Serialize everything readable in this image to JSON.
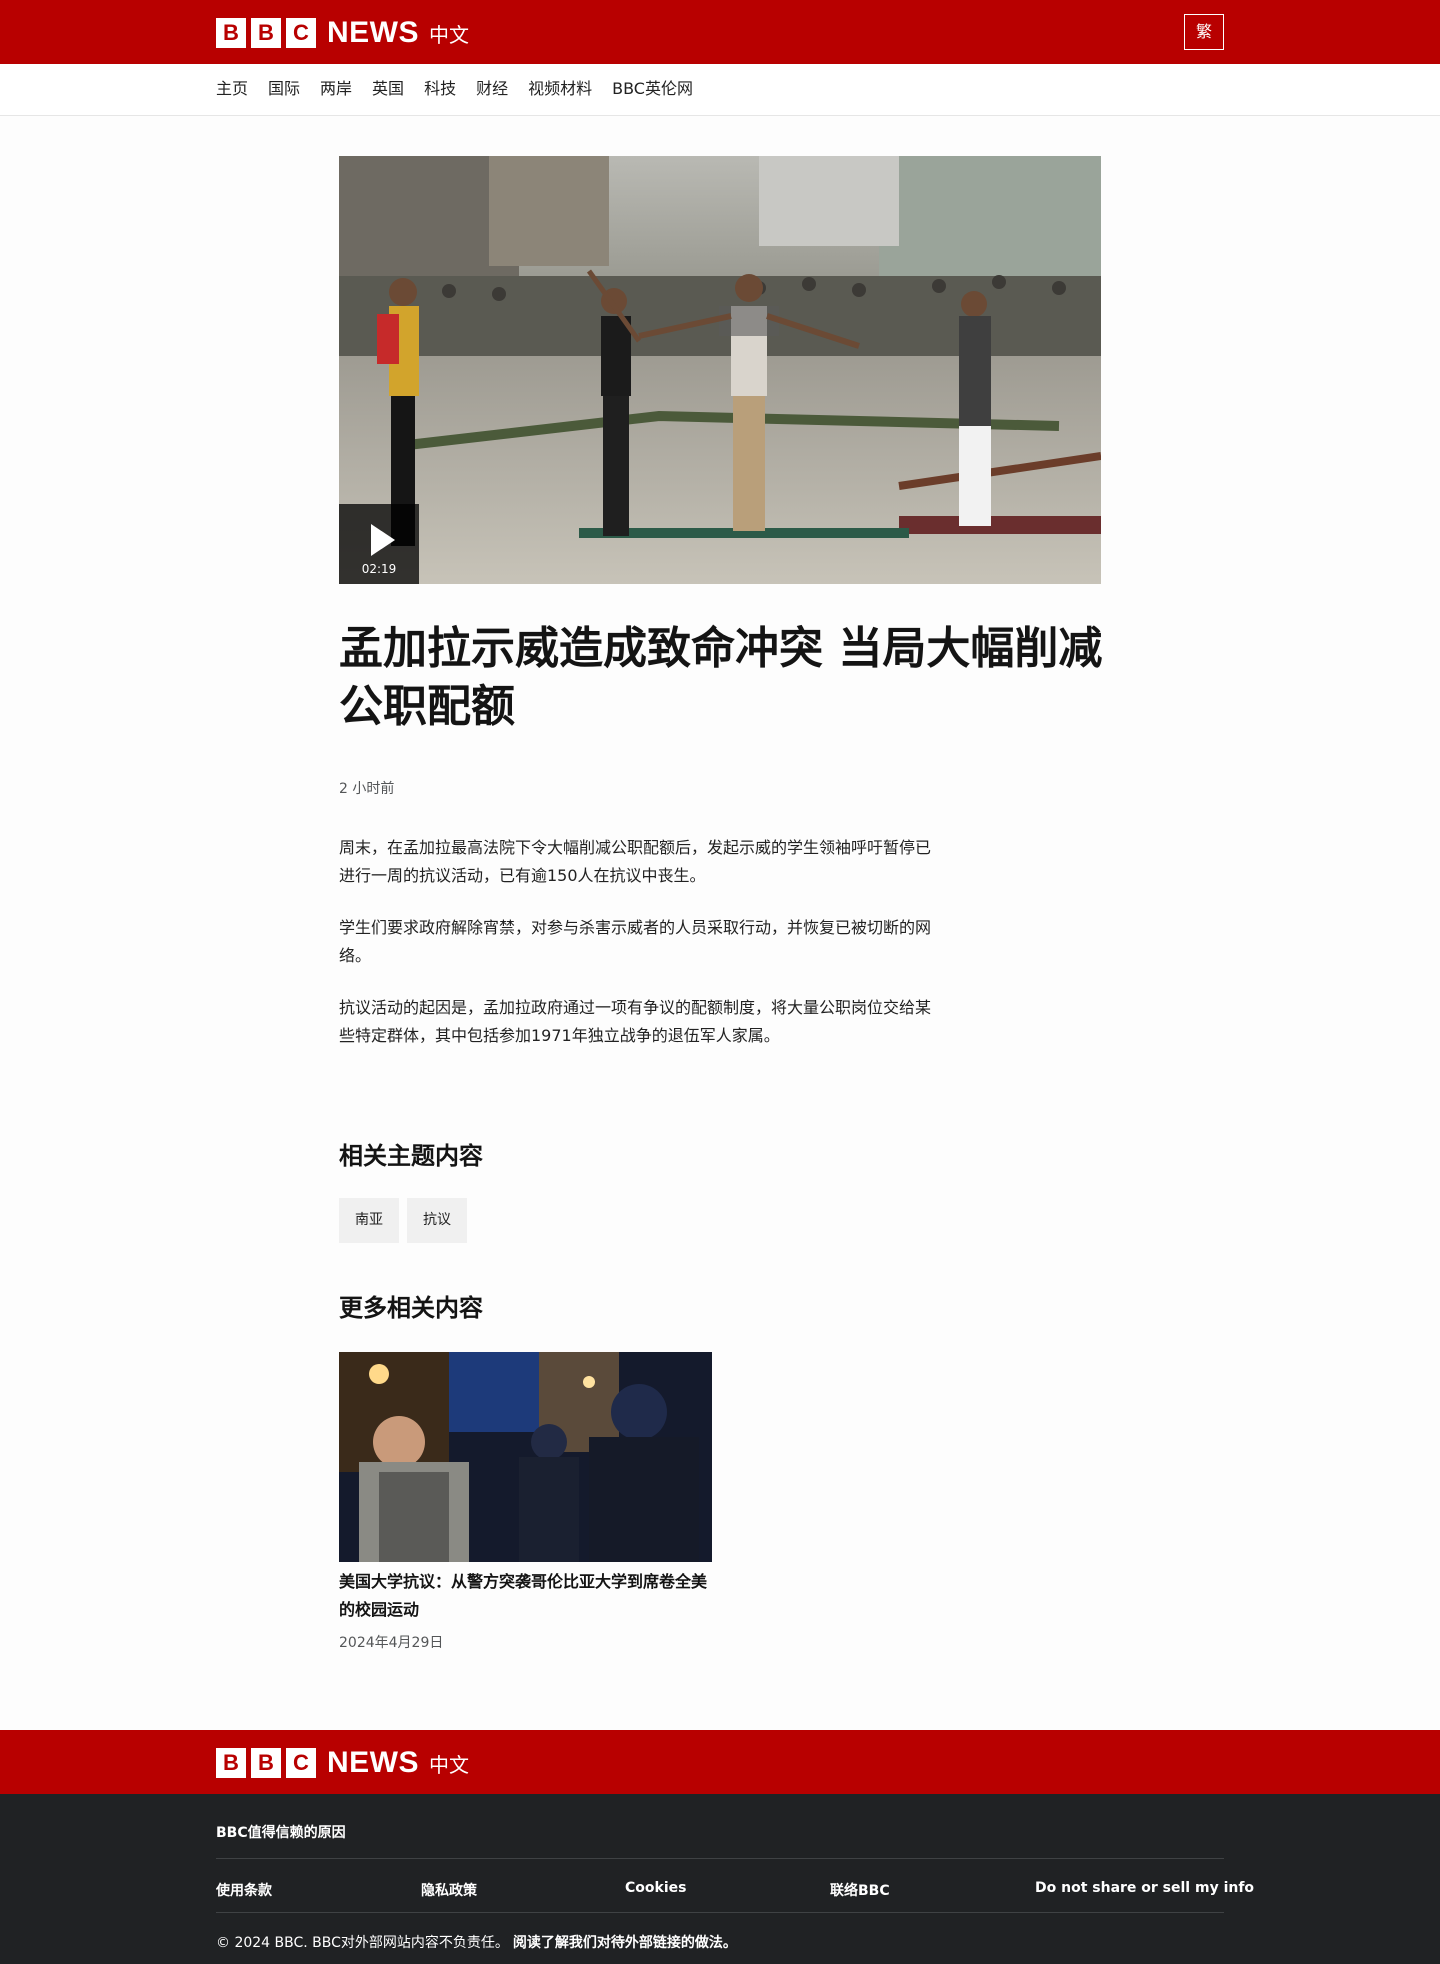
{
  "brand": {
    "letters": [
      "B",
      "B",
      "C"
    ],
    "news": "NEWS",
    "zh": "中文"
  },
  "header": {
    "lang_toggle": "繁"
  },
  "nav": {
    "items": [
      "主页",
      "国际",
      "两岸",
      "英国",
      "科技",
      "财经",
      "视频材料",
      "BBC英伦网"
    ]
  },
  "video": {
    "duration": "02:19"
  },
  "article": {
    "headline": "孟加拉示威造成致命冲突 当局大幅削减公职配额",
    "timestamp": "2 小时前",
    "paragraphs": [
      "周末，在孟加拉最高法院下令大幅削减公职配额后，发起示威的学生领袖呼吁暂停已进行一周的抗议活动，已有逾150人在抗议中丧生。",
      "学生们要求政府解除宵禁，对参与杀害示威者的人员采取行动，并恢复已被切断的网络。",
      "抗议活动的起因是，孟加拉政府通过一项有争议的配额制度，将大量公职岗位交给某些特定群体，其中包括参加1971年独立战争的退伍军人家属。"
    ]
  },
  "related_topics": {
    "title": "相关主题内容",
    "tags": [
      "南亚",
      "抗议"
    ]
  },
  "more_related": {
    "title": "更多相关内容",
    "card": {
      "title": "美国大学抗议：从警方突袭哥伦比亚大学到席卷全美的校园运动",
      "date": "2024年4月29日"
    }
  },
  "footer": {
    "trust": "BBC值得信赖的原因",
    "links": [
      "使用条款",
      "隐私政策",
      "Cookies",
      "联络BBC",
      "Do not share or sell my info"
    ],
    "copyright": "© 2024 BBC. BBC对外部网站内容不负责任。",
    "external_link": "阅读了解我们对待外部链接的做法。"
  },
  "colors": {
    "brand_red": "#b80000",
    "footer_dark": "#202224",
    "text": "#141414",
    "muted": "#545658"
  }
}
